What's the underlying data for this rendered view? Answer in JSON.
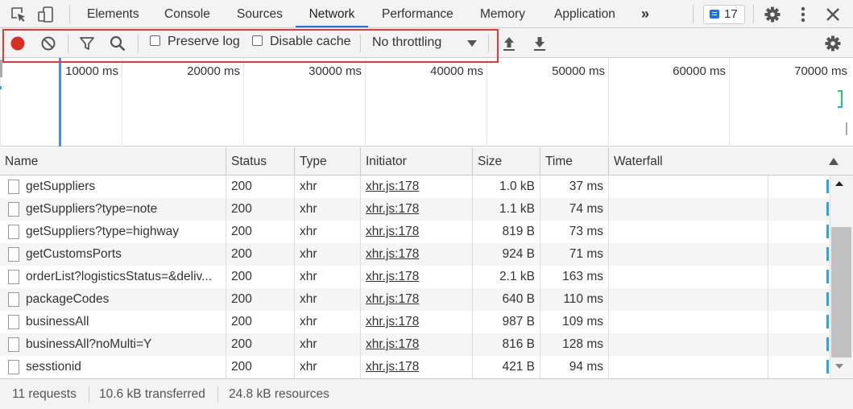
{
  "tabs": [
    "Elements",
    "Console",
    "Sources",
    "Network",
    "Performance",
    "Memory",
    "Application"
  ],
  "active_tab": "Network",
  "more_tabs_glyph": "»",
  "issues_count": "17",
  "toolbar": {
    "preserve_log_label": "Preserve log",
    "disable_cache_label": "Disable cache",
    "throttling_value": "No throttling",
    "preserve_log_checked": false,
    "disable_cache_checked": false
  },
  "overview": {
    "tick_labels": [
      "10000 ms",
      "20000 ms",
      "30000 ms",
      "40000 ms",
      "50000 ms",
      "60000 ms",
      "70000 ms"
    ]
  },
  "columns": [
    "Name",
    "Status",
    "Type",
    "Initiator",
    "Size",
    "Time",
    "Waterfall"
  ],
  "requests": [
    {
      "name": "getSuppliers",
      "status": "200",
      "type": "xhr",
      "initiator": "xhr.js:178",
      "size": "1.0 kB",
      "time": "37 ms"
    },
    {
      "name": "getSuppliers?type=note",
      "status": "200",
      "type": "xhr",
      "initiator": "xhr.js:178",
      "size": "1.1 kB",
      "time": "74 ms"
    },
    {
      "name": "getSuppliers?type=highway",
      "status": "200",
      "type": "xhr",
      "initiator": "xhr.js:178",
      "size": "819 B",
      "time": "73 ms"
    },
    {
      "name": "getCustomsPorts",
      "status": "200",
      "type": "xhr",
      "initiator": "xhr.js:178",
      "size": "924 B",
      "time": "71 ms"
    },
    {
      "name": "orderList?logisticsStatus=&deliv...",
      "status": "200",
      "type": "xhr",
      "initiator": "xhr.js:178",
      "size": "2.1 kB",
      "time": "163 ms"
    },
    {
      "name": "packageCodes",
      "status": "200",
      "type": "xhr",
      "initiator": "xhr.js:178",
      "size": "640 B",
      "time": "110 ms"
    },
    {
      "name": "businessAll",
      "status": "200",
      "type": "xhr",
      "initiator": "xhr.js:178",
      "size": "987 B",
      "time": "109 ms"
    },
    {
      "name": "businessAll?noMulti=Y",
      "status": "200",
      "type": "xhr",
      "initiator": "xhr.js:178",
      "size": "816 B",
      "time": "128 ms"
    },
    {
      "name": "sesstionid",
      "status": "200",
      "type": "xhr",
      "initiator": "xhr.js:178",
      "size": "421 B",
      "time": "94 ms"
    }
  ],
  "status_bar": {
    "requests": "11 requests",
    "transferred": "10.6 kB transferred",
    "resources": "24.8 kB resources"
  },
  "colors": {
    "accent": "#1a73e8",
    "record": "#d93025",
    "highlight_box": "#e53935",
    "waterfall_bar": "#29a8e0"
  }
}
